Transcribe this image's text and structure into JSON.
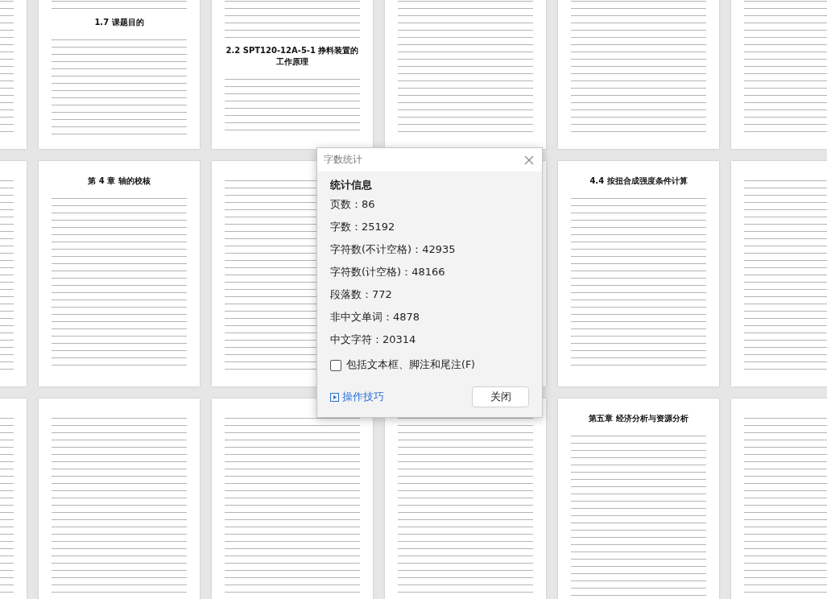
{
  "page_headings": [
    "1.7 课题目的",
    "2.2 SPT120-12A-5-1 挣料装置的工作原理",
    "第 4 章  轴的校核",
    "4.4 按扭合成强度条件计算",
    "第五章  经济分析与资源分析"
  ],
  "dialog": {
    "title": "字数统计",
    "section_title": "统计信息",
    "stats": [
      "页数：86",
      "字数：25192",
      "字符数(不计空格)：42935",
      "字符数(计空格)：48166",
      "段落数：772",
      "非中文单词：4878",
      "中文字符：20314"
    ],
    "include_checkbox": {
      "label": "包括文本框、脚注和尾注(F)",
      "checked": false
    },
    "tips_link": "操作技巧",
    "close_button": "关闭"
  }
}
